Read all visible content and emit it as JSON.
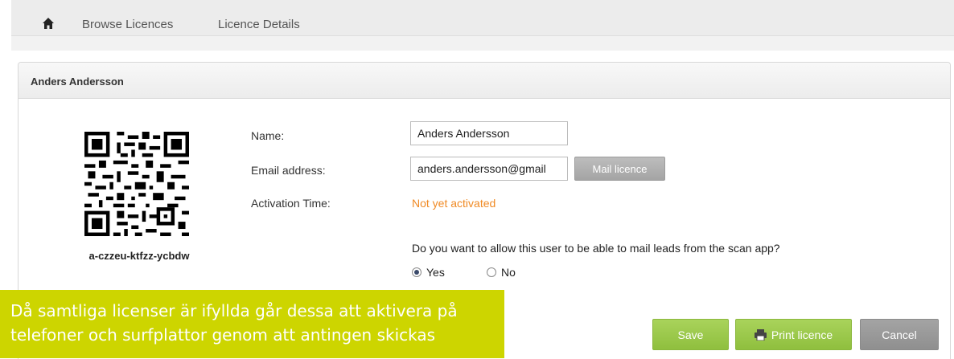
{
  "nav": {
    "home_icon": "home-icon",
    "items": [
      {
        "label": "Browse Licences"
      },
      {
        "label": "Licence Details"
      }
    ]
  },
  "panel": {
    "title": "Anders Andersson"
  },
  "licence": {
    "code": "a-czzeu-ktfzz-ycbdw",
    "qr_icon": "qr-code-icon"
  },
  "form": {
    "name_label": "Name:",
    "name_value": "Anders Andersson",
    "email_label": "Email address:",
    "email_value": "anders.andersson@gmail",
    "mail_button": "Mail licence",
    "activation_label": "Activation Time:",
    "activation_value": "Not yet activated",
    "mail_leads_question": "Do you want to allow this user to be able to mail leads from the scan app?",
    "options": [
      {
        "label": "Yes",
        "selected": true
      },
      {
        "label": "No",
        "selected": false
      }
    ]
  },
  "actions": {
    "save": "Save",
    "print": "Print licence",
    "print_icon": "printer-icon",
    "cancel": "Cancel"
  },
  "callout": {
    "text": "Då samtliga licenser är ifyllda går dessa att aktivera på telefoner och surfplattor genom att antingen skickas"
  },
  "colors": {
    "accent_green": "#8fbf3e",
    "warning_orange": "#f08a24",
    "callout_bg": "#cdd500"
  }
}
